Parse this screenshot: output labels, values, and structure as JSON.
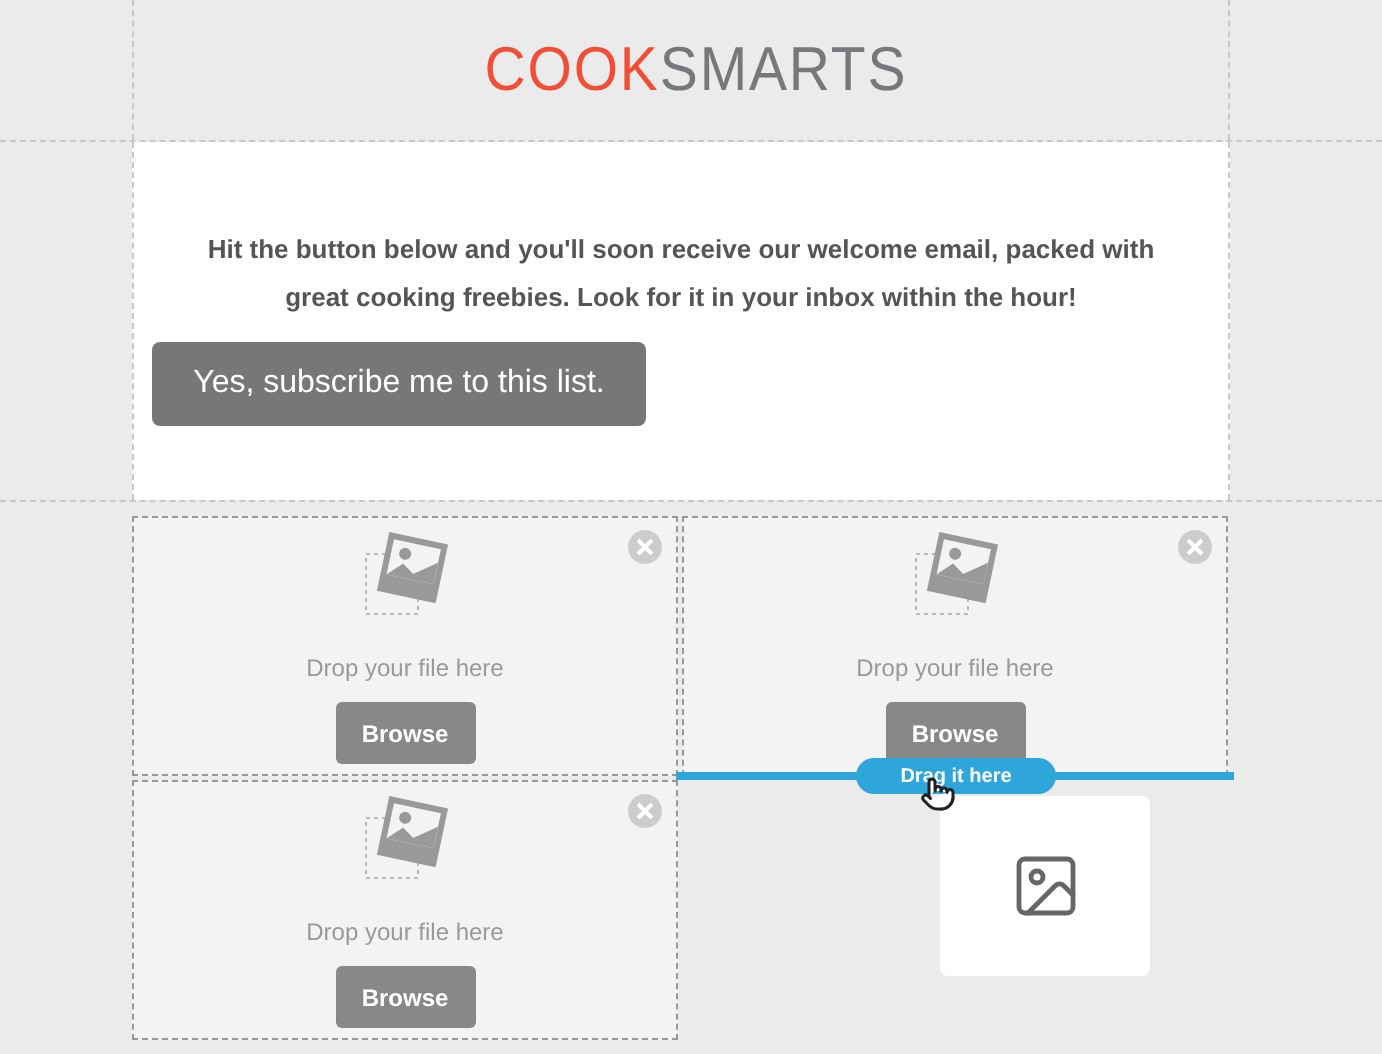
{
  "logo": {
    "parts": [
      {
        "text": "COOK",
        "color": "#f04e37"
      },
      {
        "text": "SMARTS",
        "color": "#77787b"
      }
    ]
  },
  "message": "Hit the button below and you'll soon receive our welcome email, packed with great cooking freebies. Look for it in your inbox within the hour!",
  "subscribe_button": "Yes, subscribe me to this list.",
  "drop_zones": [
    {
      "prompt": "Drop your file here",
      "button": "Browse"
    },
    {
      "prompt": "Drop your file here",
      "button": "Browse"
    },
    {
      "prompt": "Drop your file here",
      "button": "Browse"
    }
  ],
  "drop_indicator": {
    "label": "Drag it here"
  }
}
